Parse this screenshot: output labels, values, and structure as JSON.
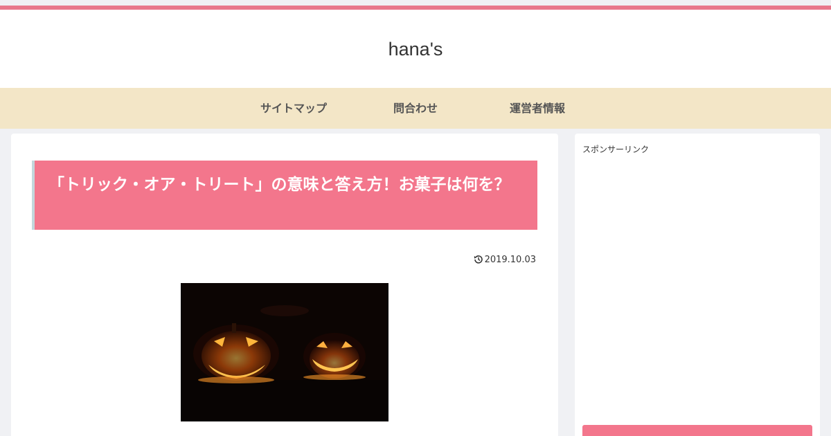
{
  "site": {
    "title": "hana's"
  },
  "nav": {
    "items": [
      {
        "label": "サイトマップ"
      },
      {
        "label": "問合わせ"
      },
      {
        "label": "運営者情報"
      }
    ]
  },
  "article": {
    "title": "「トリック・オア・トリート」の意味と答え方！お菓子は何を？",
    "date": "2019.10.03",
    "date_icon": "update-icon",
    "image": "jack-o-lantern-pumpkins"
  },
  "sidebar": {
    "sponsor_label": "スポンサーリンク"
  },
  "colors": {
    "accent": "#e8788b",
    "title_bg": "#f3768c",
    "nav_bg": "#f3e6c7",
    "page_bg": "#f0f1f4"
  }
}
